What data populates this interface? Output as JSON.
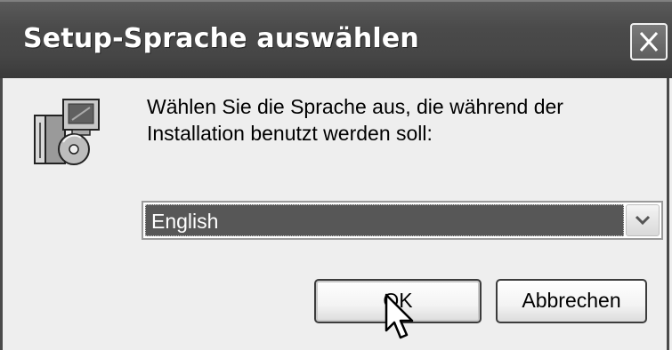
{
  "window": {
    "title": "Setup-Sprache auswählen"
  },
  "icons": {
    "close": "close-icon",
    "setup": "setup-installer-icon",
    "dropdown": "chevron-down-icon",
    "cursor": "mouse-pointer-icon"
  },
  "message": {
    "line1": "Wählen Sie die Sprache aus, die während der",
    "line2": "Installation benutzt werden soll:"
  },
  "language_select": {
    "selected": "English"
  },
  "buttons": {
    "ok_label": "OK",
    "cancel_label": "Abbrechen"
  }
}
